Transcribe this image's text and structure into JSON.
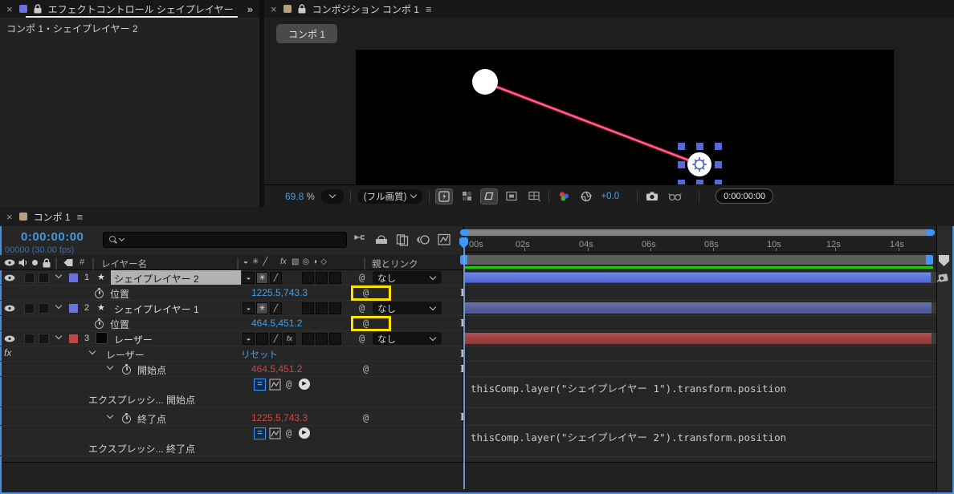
{
  "colors": {
    "accent_blue": "#3f96fd",
    "value_blue": "#4b9edc",
    "value_red": "#d04848",
    "highlight_yellow": "#ffe100",
    "layer_bar_1": "#5d79dd",
    "layer_bar_2": "#59629f",
    "layer_bar_3": "#9f4343",
    "render_bar_green": "#25c70c",
    "label_blue_square": "#6774e0",
    "label_tan_square": "#b3a27a",
    "selected_row_bg": "#b2b2b2",
    "laser_line_pink": "#ed4b6b"
  },
  "effect_controls_panel": {
    "close": "×",
    "title": "エフェクトコントロール シェイプレイヤー",
    "overflow": "»",
    "breadcrumb": "コンポ 1・シェイプレイヤー 2"
  },
  "composition_panel": {
    "close": "×",
    "title": "コンポジション コンポ 1",
    "menu": "≡",
    "comp_tab": "コンポ 1",
    "toolbar": {
      "zoom": "69.8",
      "percent": "%",
      "quality": "(フル画質)",
      "exposure": "+0.0",
      "timecode": "0:00:00:00"
    }
  },
  "timeline_panel": {
    "close": "×",
    "tab": "コンポ 1",
    "menu": "≡",
    "current_time": "0:00:00:00",
    "frame_info": "00000 (30.00 fps)",
    "columns": {
      "layer_name": "レイヤー名",
      "hash": "#",
      "parent_link": "親とリンク"
    },
    "layers": [
      {
        "index": "1",
        "name": "シェイプレイヤー 2",
        "parent": "なし",
        "prop_label": "位置",
        "prop_value": "1225.5,743.3"
      },
      {
        "index": "2",
        "name": "シェイプレイヤー 1",
        "parent": "なし",
        "prop_label": "位置",
        "prop_value": "464.5,451.2"
      },
      {
        "index": "3",
        "name": "レーザー",
        "parent": "なし"
      }
    ],
    "effect": {
      "fx_badge": "fx",
      "name": "レーザー",
      "reset": "リセット",
      "params": [
        {
          "label": "開始点",
          "value": "464.5,451.2",
          "expression_label": "エクスプレッシ... 開始点",
          "expression": "thisComp.layer(\"シェイプレイヤー 1\").transform.position"
        },
        {
          "label": "終了点",
          "value": "1225.5,743.3",
          "expression_label": "エクスプレッシ... 終了点",
          "expression": "thisComp.layer(\"シェイプレイヤー 2\").transform.position"
        }
      ]
    },
    "ruler_ticks": [
      "00s",
      "02s",
      "04s",
      "06s",
      "08s",
      "10s",
      "12s",
      "14s"
    ]
  }
}
